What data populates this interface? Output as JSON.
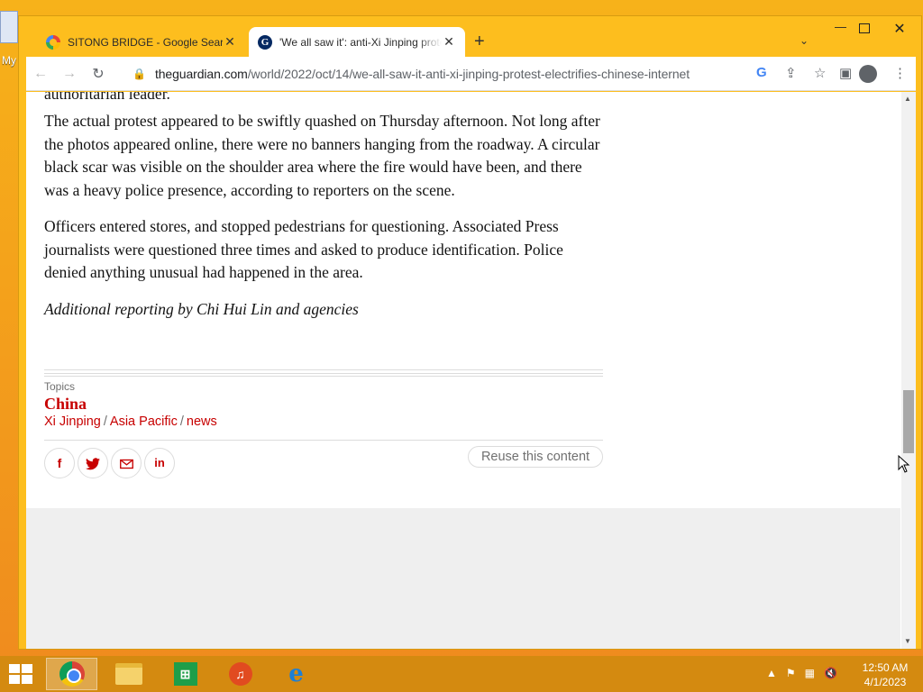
{
  "desktop": {
    "label": "My"
  },
  "browser": {
    "tabs": [
      {
        "title": "SITONG BRIDGE - Google Search",
        "favicon": "google-icon"
      },
      {
        "title": "'We all saw it': anti-Xi Jinping protest electrifies Chinese internet",
        "favicon": "guardian-icon"
      }
    ],
    "url_domain": "theguardian.com",
    "url_path": "/world/2022/oct/14/we-all-saw-it-anti-xi-jinping-protest-electrifies-chinese-internet"
  },
  "article": {
    "cutoff_text": "authoritarian leader.",
    "paragraphs": [
      "The actual protest appeared to be swiftly quashed on Thursday afternoon. Not long after the photos appeared online, there were no banners hanging from the roadway. A circular black scar was visible on the shoulder area where the fire would have been, and there was a heavy police presence, according to reporters on the scene.",
      "Officers entered stores, and stopped pedestrians for questioning. Associated Press journalists were questioned three times and asked to produce identification. Police denied anything unusual had happened in the area."
    ],
    "credit": "Additional reporting by Chi Hui Lin and agencies"
  },
  "topics": {
    "label": "Topics",
    "main": "China",
    "sub": [
      "Xi Jinping",
      "Asia Pacific",
      "news"
    ],
    "separator": "/"
  },
  "share": {
    "buttons": [
      "facebook-icon",
      "twitter-icon",
      "email-icon",
      "linkedin-icon"
    ],
    "reuse_label": "Reuse this content"
  },
  "taskbar": {
    "time": "12:50 AM",
    "date": "4/1/2023"
  },
  "colors": {
    "guardian_red": "#c70000",
    "chrome_frame": "#fdbe1e"
  }
}
